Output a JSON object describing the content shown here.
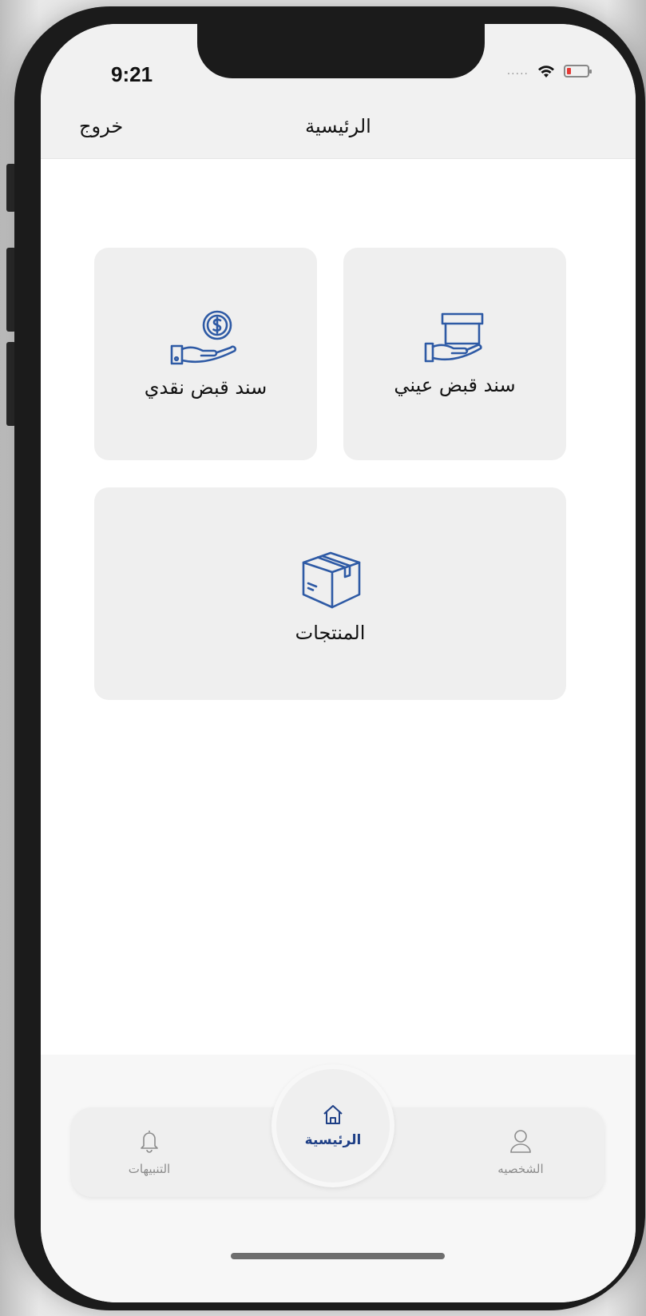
{
  "status_bar": {
    "time": "9:21",
    "signal_dots": "....."
  },
  "nav": {
    "title": "الرئيسية",
    "logout_label": "خروج"
  },
  "tiles": {
    "in_kind_receipt": {
      "label": "سند قبض عيني",
      "icon": "box-on-hand-icon"
    },
    "cash_receipt": {
      "label": "سند قبض نقدي",
      "icon": "coin-on-hand-icon"
    },
    "products": {
      "label": "المنتجات",
      "icon": "package-icon"
    }
  },
  "tab_bar": {
    "profile_label": "الشخصيه",
    "home_label": "الرئيسية",
    "notifications_label": "التنبيهات"
  },
  "colors": {
    "accent": "#1e3f86",
    "icon_blue": "#2e5aa5",
    "tile_bg": "#efefef",
    "header_bg": "#f1f1f1",
    "battery_low": "#e53935"
  }
}
